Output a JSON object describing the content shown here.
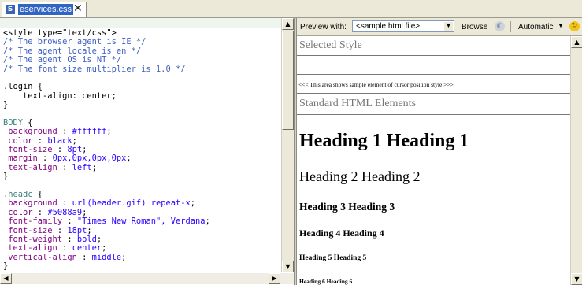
{
  "tab": {
    "icon": "css-file-icon",
    "title": "eservices.css",
    "close": "✕"
  },
  "editor": {
    "lines": [
      [
        [
          "plain",
          "<style type=\"text/css\">"
        ]
      ],
      [
        [
          "comment",
          "/* The browser agent is IE */"
        ]
      ],
      [
        [
          "comment",
          "/* The agent locale is en */"
        ]
      ],
      [
        [
          "comment",
          "/* The agent OS is NT */"
        ]
      ],
      [
        [
          "comment",
          "/* The font size multiplier is 1.0 */"
        ]
      ],
      [
        [
          "plain",
          ""
        ]
      ],
      [
        [
          "plain",
          ".login {"
        ]
      ],
      [
        [
          "plain",
          "    text-align: center;"
        ]
      ],
      [
        [
          "plain",
          "}"
        ]
      ],
      [
        [
          "plain",
          ""
        ]
      ],
      [
        [
          "sel",
          "BODY"
        ],
        [
          "plain",
          " {"
        ]
      ],
      [
        [
          "prop",
          " background"
        ],
        [
          "plain",
          " : "
        ],
        [
          "val",
          "#ffffff"
        ],
        [
          "plain",
          ";"
        ]
      ],
      [
        [
          "prop",
          " color"
        ],
        [
          "plain",
          " : "
        ],
        [
          "val",
          "black"
        ],
        [
          "plain",
          ";"
        ]
      ],
      [
        [
          "prop",
          " font-size"
        ],
        [
          "plain",
          " : "
        ],
        [
          "val",
          "8pt"
        ],
        [
          "plain",
          ";"
        ]
      ],
      [
        [
          "prop",
          " margin"
        ],
        [
          "plain",
          " : "
        ],
        [
          "val",
          "0px,0px,0px,0px"
        ],
        [
          "plain",
          ";"
        ]
      ],
      [
        [
          "prop",
          " text-align"
        ],
        [
          "plain",
          " : "
        ],
        [
          "val",
          "left"
        ],
        [
          "plain",
          ";"
        ]
      ],
      [
        [
          "plain",
          "}"
        ]
      ],
      [
        [
          "plain",
          ""
        ]
      ],
      [
        [
          "sel",
          ".headc"
        ],
        [
          "plain",
          " {"
        ]
      ],
      [
        [
          "prop",
          " background"
        ],
        [
          "plain",
          " : "
        ],
        [
          "val",
          "url(header.gif) repeat-x"
        ],
        [
          "plain",
          ";"
        ]
      ],
      [
        [
          "prop",
          " color"
        ],
        [
          "plain",
          " : "
        ],
        [
          "val",
          "#5088a9"
        ],
        [
          "plain",
          ";"
        ]
      ],
      [
        [
          "prop",
          " font-family"
        ],
        [
          "plain",
          " : "
        ],
        [
          "val",
          "\"Times New Roman\", Verdana"
        ],
        [
          "plain",
          ";"
        ]
      ],
      [
        [
          "prop",
          " font-size"
        ],
        [
          "plain",
          " : "
        ],
        [
          "val",
          "18pt"
        ],
        [
          "plain",
          ";"
        ]
      ],
      [
        [
          "prop",
          " font-weight"
        ],
        [
          "plain",
          " : "
        ],
        [
          "val",
          "bold"
        ],
        [
          "plain",
          ";"
        ]
      ],
      [
        [
          "prop",
          " text-align"
        ],
        [
          "plain",
          " : "
        ],
        [
          "val",
          "center"
        ],
        [
          "plain",
          ";"
        ]
      ],
      [
        [
          "prop",
          " vertical-align"
        ],
        [
          "plain",
          " : "
        ],
        [
          "val",
          "middle"
        ],
        [
          "plain",
          ";"
        ]
      ],
      [
        [
          "plain",
          "}"
        ]
      ]
    ]
  },
  "preview_toolbar": {
    "preview_with_label": "Preview with:",
    "sample_file": "<sample html file>",
    "browse_label": "Browse",
    "mode_label": "Automatic"
  },
  "preview": {
    "selected_style": "Selected Style",
    "notice": "<<< This area shows sample element of cursor position style >>>",
    "standard_elements": "Standard HTML Elements",
    "headings": [
      "Heading 1 Heading 1",
      "Heading 2 Heading 2",
      "Heading 3 Heading 3",
      "Heading 4 Heading 4",
      "Heading 5 Heading 5",
      "Heading 6 Heading 6"
    ]
  },
  "colors": {
    "comment": "#3f5fbf",
    "property": "#7f007f",
    "value": "#2a00ff",
    "selector": "#3f7f7f",
    "tab_highlight": "#3165c4"
  }
}
